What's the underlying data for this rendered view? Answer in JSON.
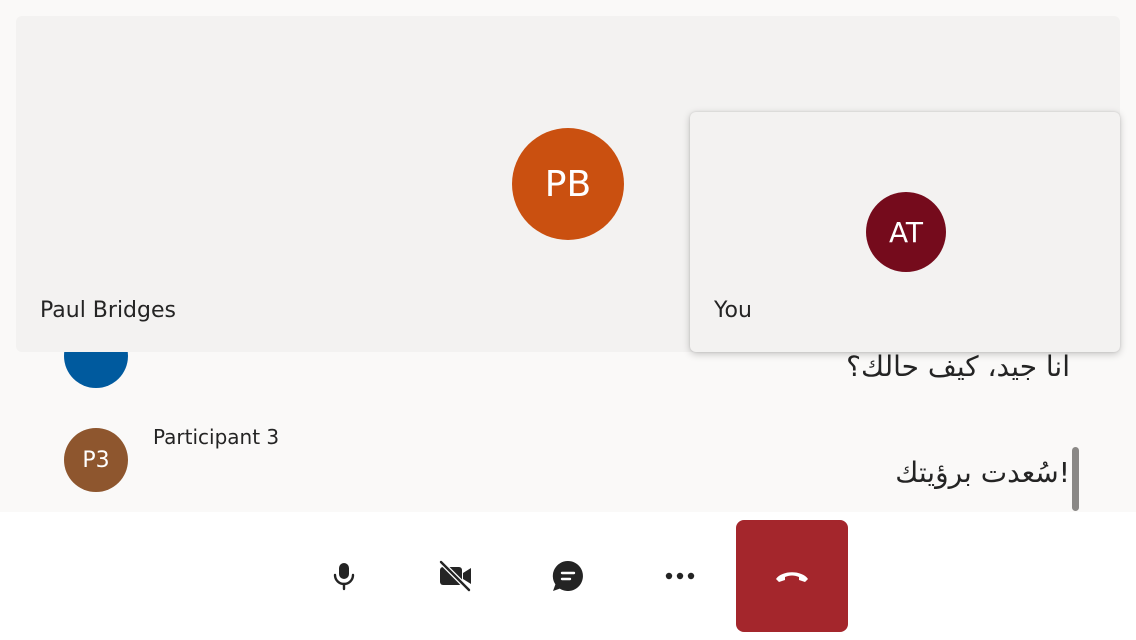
{
  "stage": {
    "main_participant": {
      "initials": "PB",
      "name": "Paul Bridges",
      "color": "#ca5010"
    },
    "self": {
      "initials": "AT",
      "name": "You",
      "color": "#750b1c"
    }
  },
  "captions": [
    {
      "speaker": "",
      "initials": "",
      "avatar_color": "#005a9e",
      "text": "انا جيد، كيف حالك؟"
    },
    {
      "speaker": "Participant 3",
      "initials": "P3",
      "avatar_color": "#8e562e",
      "text": "!سُعدت برؤيتك"
    }
  ],
  "controls": [
    {
      "icon": "microphone-icon"
    },
    {
      "icon": "camera-off-icon"
    },
    {
      "icon": "chat-icon"
    },
    {
      "icon": "more-options-icon"
    },
    {
      "icon": "hang-up-icon",
      "color": "#a4262c"
    }
  ]
}
